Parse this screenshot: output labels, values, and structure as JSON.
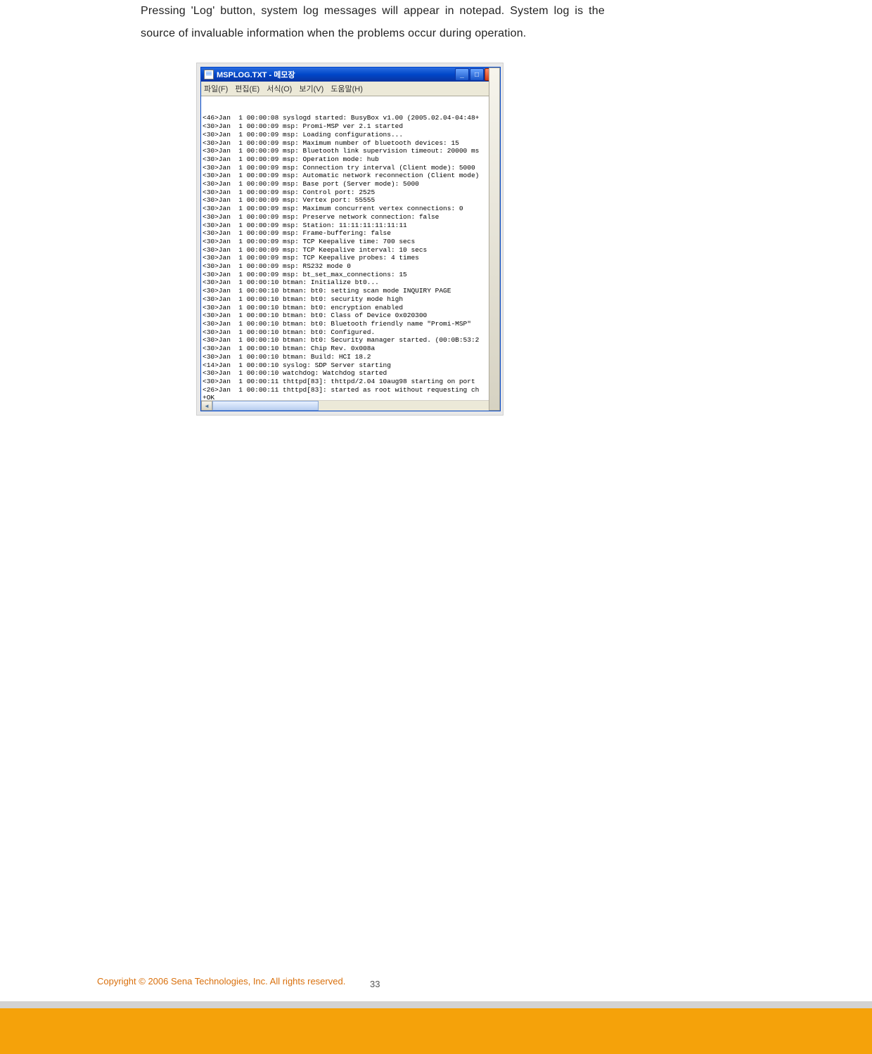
{
  "body_text": "Pressing 'Log' button, system log messages will appear in notepad. System log is the source of invaluable information when the problems occur during operation.",
  "footer": {
    "copyright": "Copyright © 2006 Sena Technologies, Inc. All rights reserved.",
    "page_number": "33"
  },
  "window": {
    "title": "MSPLOG.TXT - 메모장",
    "menus": {
      "file": "파일(F)",
      "edit": "편집(E)",
      "format": "서식(O)",
      "view": "보기(V)",
      "help": "도움말(H)"
    },
    "log_lines": [
      "<46>Jan  1 00:00:08 syslogd started: BusyBox v1.00 (2005.02.04-04:48+",
      "<30>Jan  1 00:00:09 msp: Promi-MSP ver 2.1 started",
      "<30>Jan  1 00:00:09 msp: Loading configurations...",
      "<30>Jan  1 00:00:09 msp: Maximum number of bluetooth devices: 15",
      "<30>Jan  1 00:00:09 msp: Bluetooth link supervision timeout: 20000 ms",
      "<30>Jan  1 00:00:09 msp: Operation mode: hub",
      "<30>Jan  1 00:00:09 msp: Connection try interval (Client mode): 5000",
      "<30>Jan  1 00:00:09 msp: Automatic network reconnection (Client mode)",
      "<30>Jan  1 00:00:09 msp: Base port (Server mode): 5000",
      "<30>Jan  1 00:00:09 msp: Control port: 2525",
      "<30>Jan  1 00:00:09 msp: Vertex port: 55555",
      "<30>Jan  1 00:00:09 msp: Maximum concurrent vertex connections: 0",
      "<30>Jan  1 00:00:09 msp: Preserve network connection: false",
      "<30>Jan  1 00:00:09 msp: Station: 11:11:11:11:11:11",
      "<30>Jan  1 00:00:09 msp: Frame-buffering: false",
      "<30>Jan  1 00:00:09 msp: TCP Keepalive time: 700 secs",
      "<30>Jan  1 00:00:09 msp: TCP Keepalive interval: 10 secs",
      "<30>Jan  1 00:00:09 msp: TCP Keepalive probes: 4 times",
      "<30>Jan  1 00:00:09 msp: RS232 mode 0",
      "<30>Jan  1 00:00:09 msp: bt_set_max_connections: 15",
      "<30>Jan  1 00:00:10 btman: Initialize bt0...",
      "<30>Jan  1 00:00:10 btman: bt0: setting scan mode INQUIRY PAGE",
      "<30>Jan  1 00:00:10 btman: bt0: security mode high",
      "<30>Jan  1 00:00:10 btman: bt0: encryption enabled",
      "<30>Jan  1 00:00:10 btman: bt0: Class of Device 0x020300",
      "<30>Jan  1 00:00:10 btman: bt0: Bluetooth friendly name \"Promi-MSP\"",
      "<30>Jan  1 00:00:10 btman: bt0: Configured.",
      "<30>Jan  1 00:00:10 btman: bt0: Security manager started. (00:0B:53:2",
      "<30>Jan  1 00:00:10 btman: Chip Rev. 0x008a",
      "<30>Jan  1 00:00:10 btman: Build: HCI 18.2",
      "<14>Jan  1 00:00:10 syslog: SDP Server starting",
      "<30>Jan  1 00:00:10 watchdog: Watchdog started",
      "<30>Jan  1 00:00:11 thttpd[83]: thttpd/2.04 10aug98 starting on port",
      "<26>Jan  1 00:00:11 thttpd[83]: started as root without requesting ch",
      "+OK"
    ]
  }
}
